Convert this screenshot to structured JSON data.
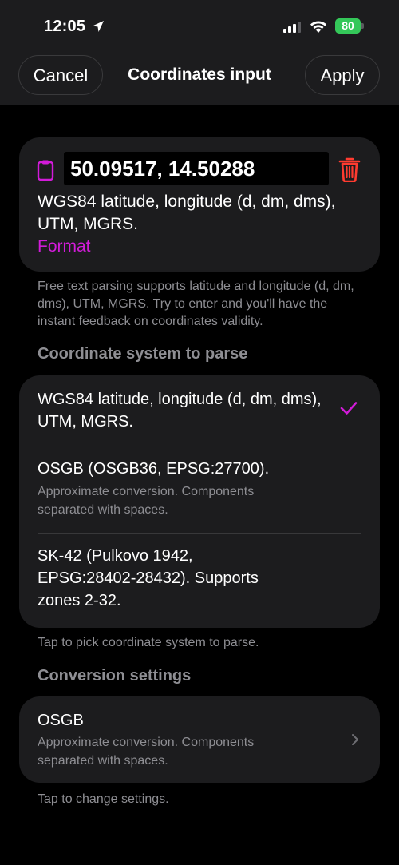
{
  "status_bar": {
    "time": "12:05",
    "battery": "80"
  },
  "nav": {
    "cancel_label": "Cancel",
    "title": "Coordinates input",
    "apply_label": "Apply"
  },
  "input": {
    "value": "50.09517, 14.50288",
    "description": "WGS84 latitude, longitude (d, dm, dms), UTM, MGRS.",
    "format_link": "Format"
  },
  "input_help": "Free text parsing supports latitude and longitude (d, dm, dms), UTM, MGRS. Try to enter and you'll have the instant feedback on coordinates validity.",
  "coordinate_system": {
    "header": "Coordinate system to parse",
    "options": [
      {
        "title": "WGS84 latitude, longitude (d, dm, dms), UTM, MGRS.",
        "subtitle": "",
        "selected": true
      },
      {
        "title": "OSGB (OSGB36, EPSG:27700).",
        "subtitle": "Approximate conversion. Components separated with spaces.",
        "selected": false
      },
      {
        "title": "SK-42 (Pulkovo 1942, EPSG:28402-28432). Supports zones 2-32.",
        "subtitle": "",
        "selected": false
      }
    ],
    "footer": "Tap to pick coordinate system to parse."
  },
  "conversion": {
    "header": "Conversion settings",
    "title": "OSGB",
    "subtitle": "Approximate conversion. Components separated with spaces.",
    "footer": "Tap to change settings."
  },
  "colors": {
    "accent": "#d21bd9",
    "delete": "#ff3b30",
    "battery": "#34c759",
    "card": "#1c1c1e",
    "secondary_text": "#8e8e93"
  },
  "icons": [
    "location-arrow-icon",
    "cellular-signal-icon",
    "wifi-icon",
    "battery-icon",
    "clipboard-icon",
    "trash-icon",
    "checkmark-icon",
    "chevron-right-icon"
  ]
}
